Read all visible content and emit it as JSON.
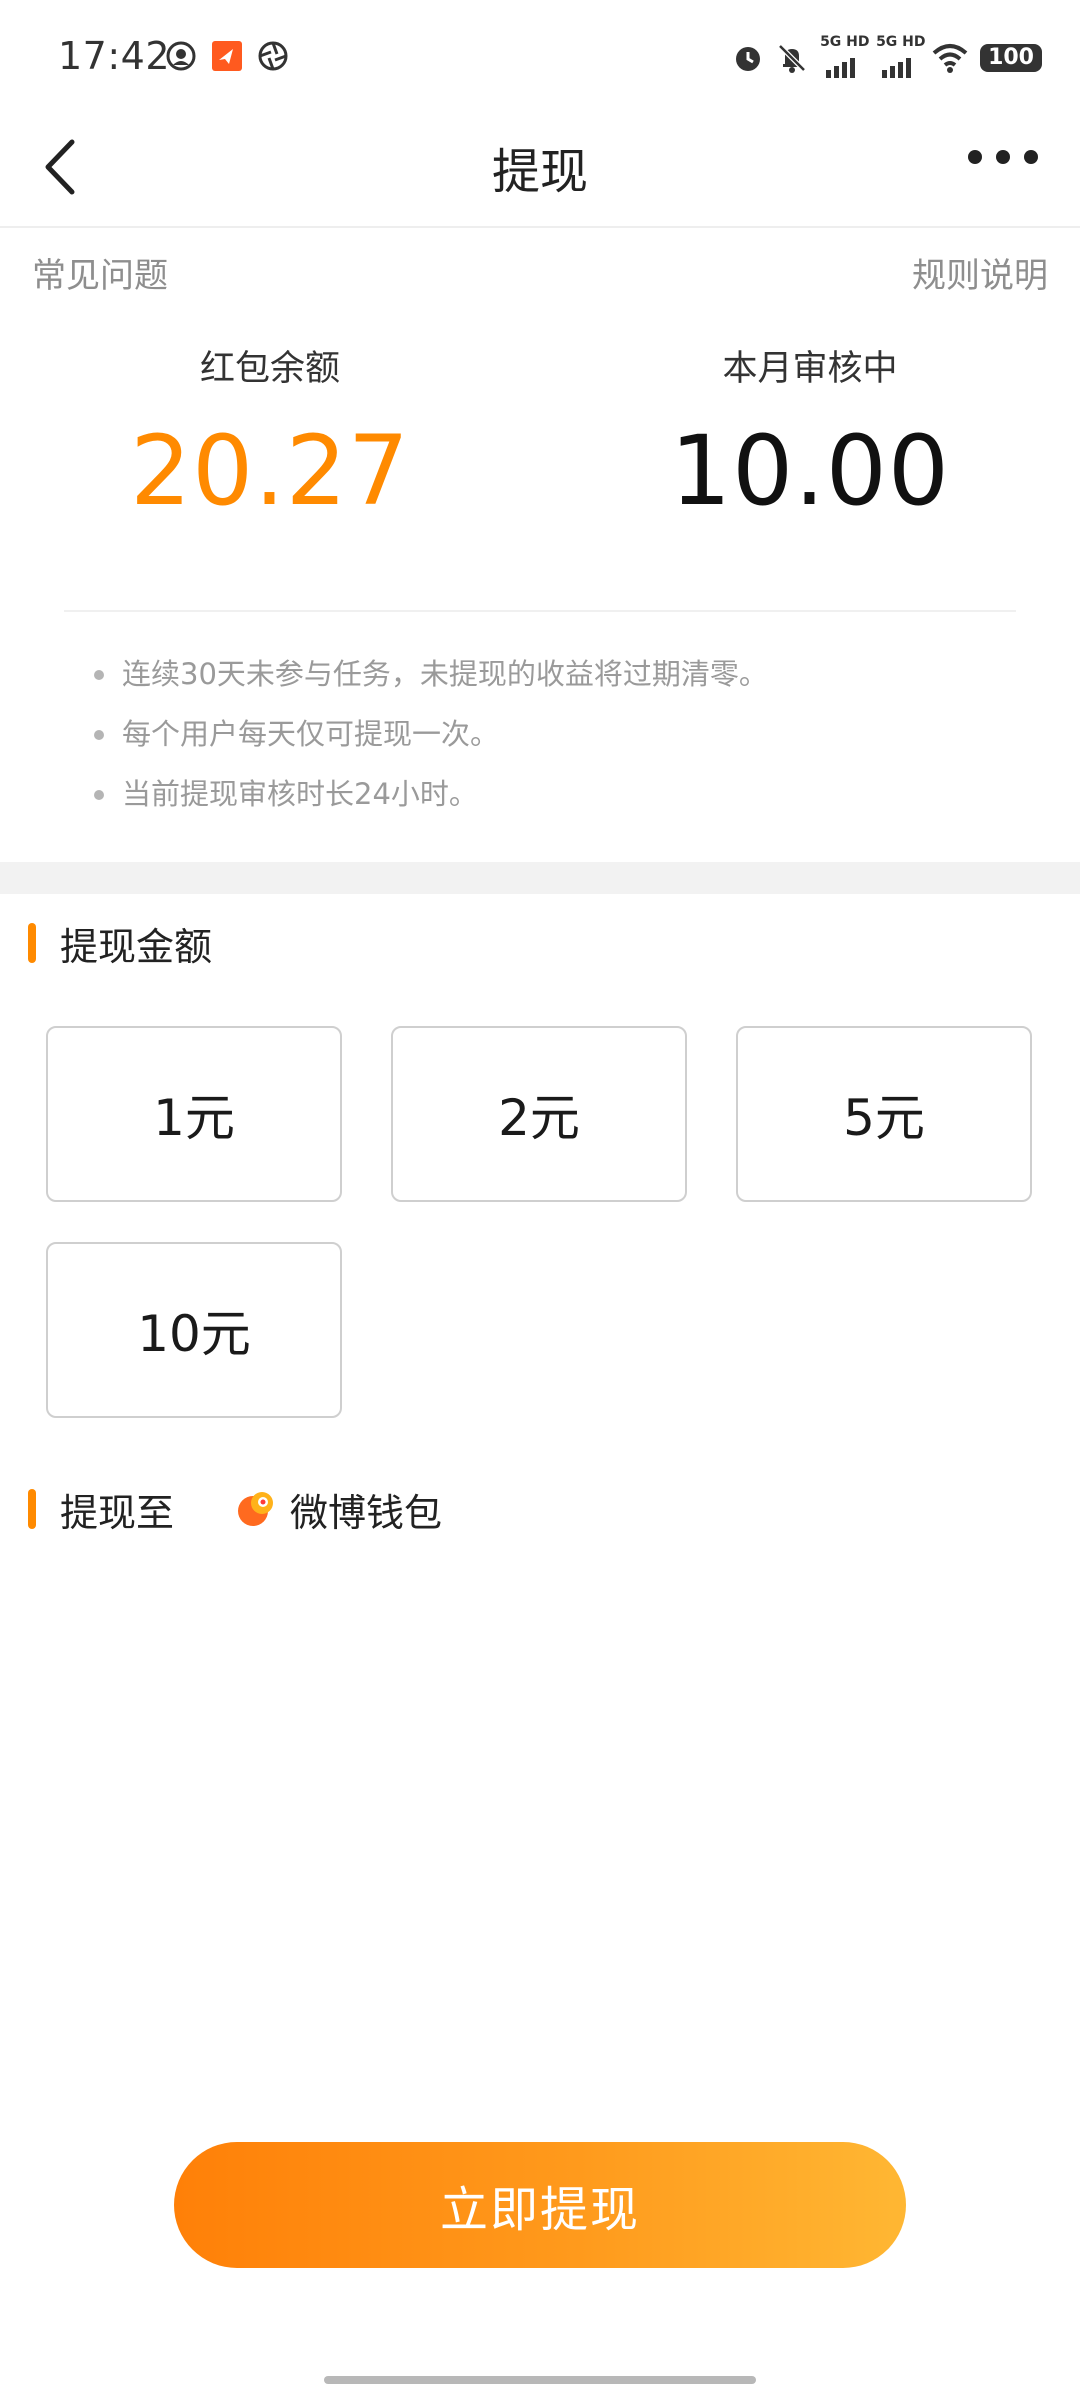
{
  "status_bar": {
    "time": "17:42",
    "left_icons": [
      "notification-circle-icon",
      "app-badge-icon",
      "aperture-icon"
    ],
    "right_icons": [
      "alarm-icon",
      "mute-bell-icon",
      "signal-5g-icon",
      "signal-5g-icon",
      "wifi-icon"
    ],
    "sim1_label": "5G HD",
    "sim2_label": "5G HD",
    "battery": "100"
  },
  "nav": {
    "title": "提现",
    "back_icon": "chevron-left-icon",
    "more_icon": "more-dots-icon"
  },
  "top_links": {
    "faq": "常见问题",
    "rules": "规则说明"
  },
  "balances": {
    "left": {
      "label": "红包余额",
      "value": "20.27"
    },
    "right": {
      "label": "本月审核中",
      "value": "10.00"
    }
  },
  "tips": [
    "连续30天未参与任务，未提现的收益将过期清零。",
    "每个用户每天仅可提现一次。",
    "当前提现审核时长24小时。"
  ],
  "amount_section": {
    "title": "提现金额",
    "options": [
      "1元",
      "2元",
      "5元",
      "10元"
    ]
  },
  "destination": {
    "title": "提现至",
    "wallet_icon": "weibo-wallet-icon",
    "wallet_name": "微博钱包"
  },
  "submit_label": "立即提现",
  "colors": {
    "accent": "#ff8a00",
    "button_gradient_start": "#ff8008",
    "button_gradient_end": "#ffb733"
  }
}
